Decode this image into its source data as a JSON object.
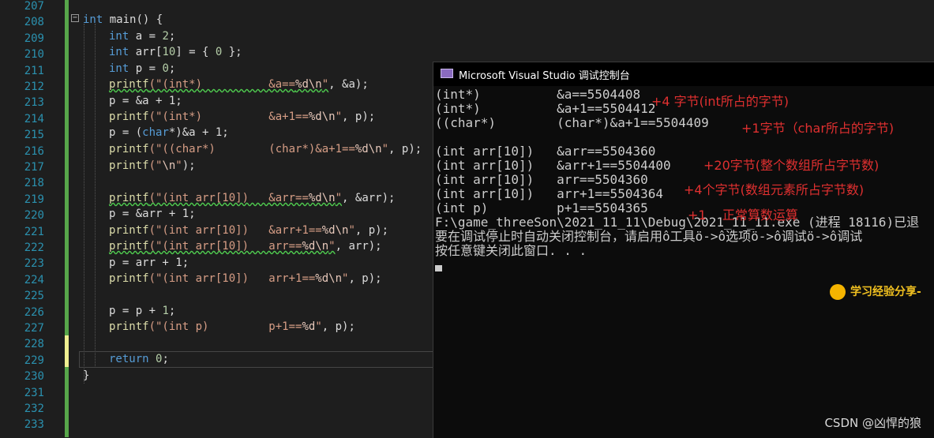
{
  "editor": {
    "line_numbers": [
      "207",
      "208",
      "209",
      "210",
      "211",
      "212",
      "213",
      "214",
      "215",
      "216",
      "217",
      "218",
      "219",
      "220",
      "221",
      "222",
      "223",
      "224",
      "225",
      "226",
      "227",
      "228",
      "229",
      "230",
      "231",
      "232",
      "233"
    ],
    "fold_glyph": "−",
    "code": {
      "l208": {
        "t1": "int",
        "t2": " main() {"
      },
      "l209": {
        "t1": "int",
        "t2": " a = ",
        "t3": "2",
        "t4": ";"
      },
      "l210": {
        "t1": "int",
        "t2": " arr[",
        "t3": "10",
        "t4": "] = { ",
        "t5": "0",
        "t6": " };"
      },
      "l211": {
        "t1": "int",
        "t2": " p = ",
        "t3": "0",
        "t4": ";"
      },
      "l212": {
        "fn": "printf",
        "s1": "(\"(int*)          &a==",
        "esc": "%d\\n",
        "s2": "\"",
        "rest": ", &a);"
      },
      "l213": {
        "t": "p = &a + 1;"
      },
      "l214": {
        "fn": "printf",
        "s1": "(\"(int*)          &a+1==",
        "esc": "%d\\n",
        "s2": "\"",
        "rest": ", p);"
      },
      "l215": {
        "t1": "p = (",
        "kw": "char",
        "t2": "*)&a + 1;"
      },
      "l216": {
        "fn": "printf",
        "s1": "(\"((char*)        (char*)&a+1==",
        "esc": "%d\\n",
        "s2": "\"",
        "rest": ", p);"
      },
      "l217": {
        "fn": "printf",
        "s1": "(\"",
        "esc": "\\n",
        "s2": "\"",
        "rest": ");"
      },
      "l219": {
        "fn": "printf",
        "s1": "(\"(int arr[10])   &arr==",
        "esc": "%d\\n",
        "s2": "\"",
        "rest": ", &arr);"
      },
      "l220": {
        "t": "p = &arr + 1;"
      },
      "l221": {
        "fn": "printf",
        "s1": "(\"(int arr[10])   &arr+1==",
        "esc": "%d\\n",
        "s2": "\"",
        "rest": ", p);"
      },
      "l222": {
        "fn": "printf",
        "s1": "(\"(int arr[10])   arr==",
        "esc": "%d\\n",
        "s2": "\"",
        "rest": ", arr);"
      },
      "l223": {
        "t": "p = arr + 1;"
      },
      "l224": {
        "fn": "printf",
        "s1": "(\"(int arr[10])   arr+1==",
        "esc": "%d\\n",
        "s2": "\"",
        "rest": ", p);"
      },
      "l226": {
        "t1": "p = p + ",
        "t2": "1",
        "t3": ";"
      },
      "l227": {
        "fn": "printf",
        "s1": "(\"(int p)         p+1==",
        "esc": "%d",
        "s2": "\"",
        "rest": ", p);"
      },
      "l229": {
        "kw": "return",
        "t1": " ",
        "t2": "0",
        "t3": ";"
      },
      "l230": {
        "t": "}"
      }
    }
  },
  "console": {
    "title": "Microsoft Visual Studio 调试控制台",
    "lines": [
      "(int*)          &a==5504408",
      "(int*)          &a+1==5504412",
      "((char*)        (char*)&a+1==5504409",
      "",
      "(int arr[10])   &arr==5504360",
      "(int arr[10])   &arr+1==5504400",
      "(int arr[10])   arr==5504360",
      "(int arr[10])   arr+1==5504364",
      "(int p)         p+1==5504365",
      "F:\\game_threeSon\\2021_11_11\\Debug\\2021_11_11.exe (进程 18116)已退",
      "要在调试停止时自动关闭控制台，请启用ô工具ö->ô选项ö->ô调试ö->ô调试",
      "按任意键关闭此窗口. . ."
    ],
    "annotations": [
      "+4 字节(int所占的字节)",
      "+1字节（char所占的字节)",
      "+20字节(整个数组所占字节数)",
      "+4个字节(数组元素所占字节数)",
      "+1    正常算数运算"
    ],
    "colors": {
      "annotation": "#e03030",
      "text": "#cccccc",
      "background": "#0c0c0c"
    }
  },
  "badge": {
    "icon": "circle-icon",
    "text": "学习经验分享-"
  },
  "watermark": "CSDN @凶悍的狼"
}
